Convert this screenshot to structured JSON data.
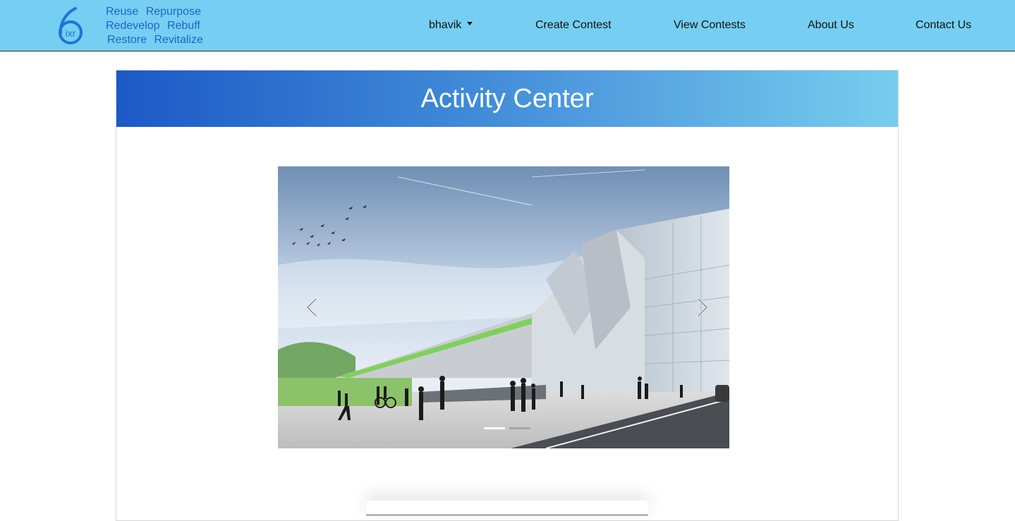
{
  "brand": {
    "logo_icon": "six-ixr-logo-icon",
    "logo_text": "ixr",
    "tagline": [
      [
        "Reuse",
        "Repurpose"
      ],
      [
        "Redevelop",
        "Rebuff"
      ],
      [
        "Restore",
        "Revitalize"
      ]
    ],
    "accent": "#1e63c7",
    "navbar_color": "#76cff2"
  },
  "nav": {
    "user_label": "bhavik",
    "create_contest": "Create Contest",
    "view_contests": "View Contests",
    "about_us": "About Us",
    "contact_us": "Contact Us"
  },
  "page": {
    "title": "Activity Center"
  },
  "carousel": {
    "prev_icon": "chevron-left-icon",
    "next_icon": "chevron-right-icon",
    "slide_count": 2,
    "active_index": 0
  }
}
